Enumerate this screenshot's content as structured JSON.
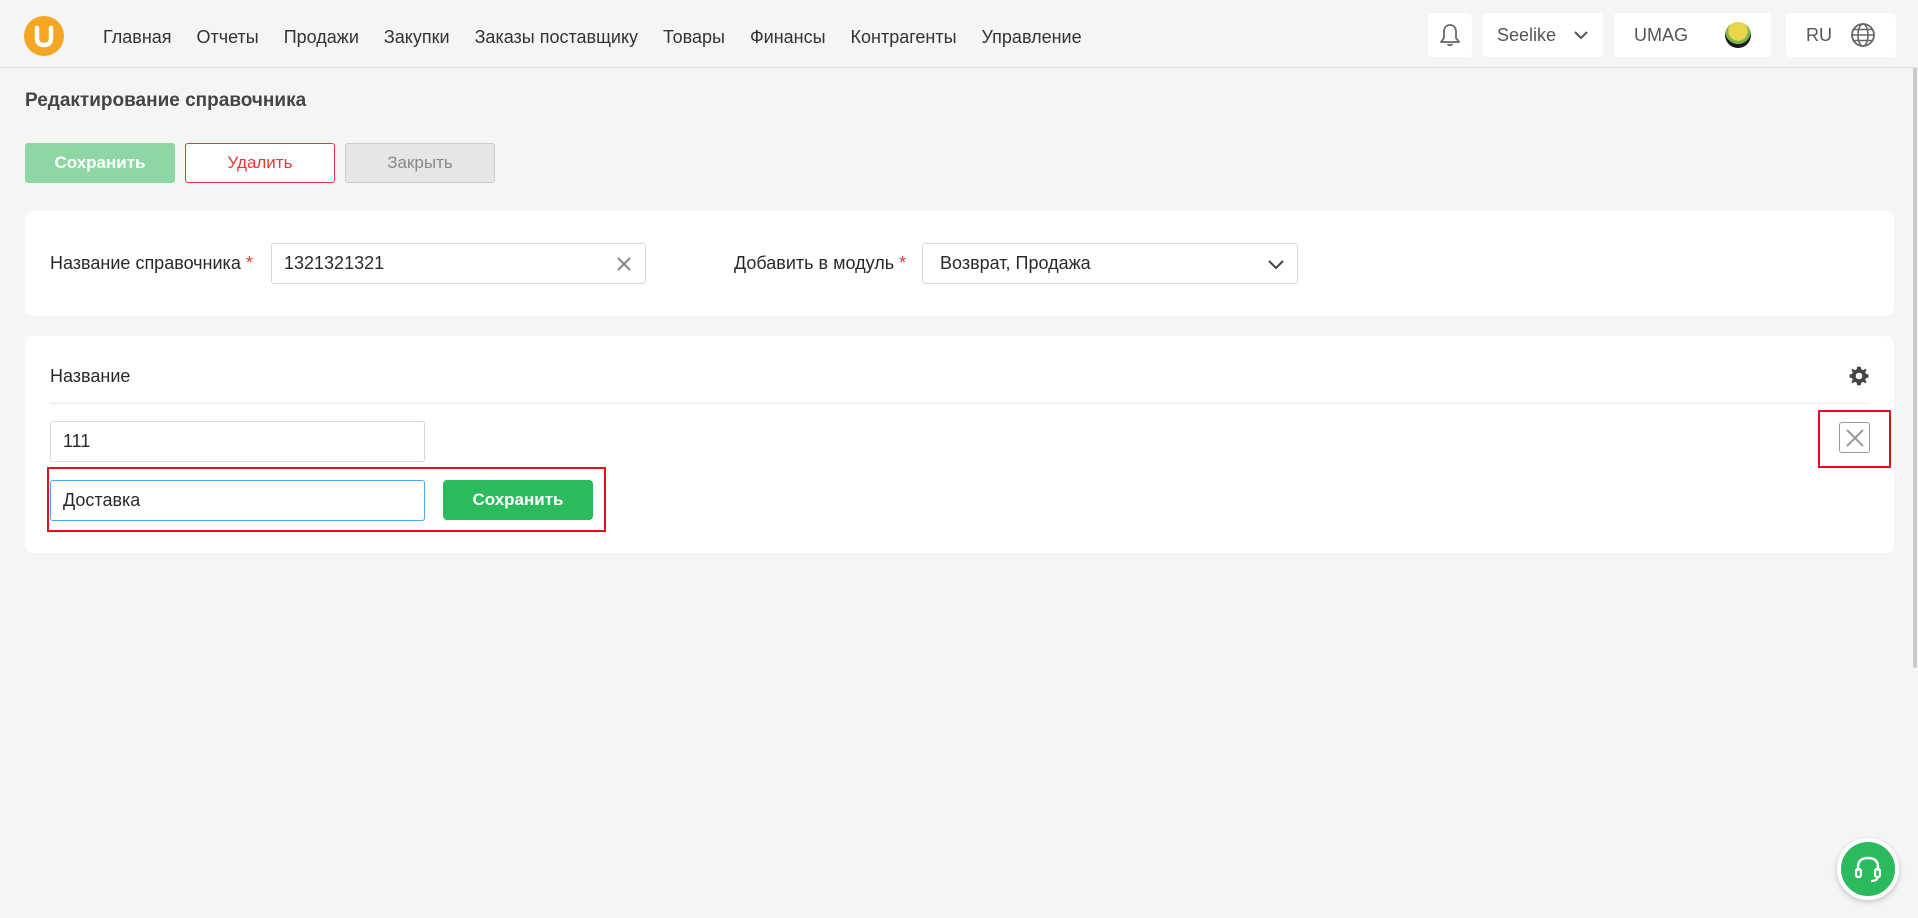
{
  "nav": {
    "items": [
      "Главная",
      "Отчеты",
      "Продажи",
      "Закупки",
      "Заказы поставщику",
      "Товары",
      "Финансы",
      "Контрагенты",
      "Управление"
    ]
  },
  "header": {
    "org_name": "Seelike",
    "brand": "UMAG",
    "language": "RU"
  },
  "page": {
    "title": "Редактирование справочника",
    "save_label": "Сохранить",
    "delete_label": "Удалить",
    "close_label": "Закрыть"
  },
  "form": {
    "name_label": "Название справочника",
    "name_value": "1321321321",
    "module_label": "Добавить в модуль",
    "module_value": "Возврат, Продажа",
    "required_mark": "*"
  },
  "table": {
    "column_title": "Название",
    "rows": [
      "111"
    ],
    "new_entry_value": "Доставка",
    "new_entry_save_label": "Сохранить"
  },
  "colors": {
    "accent_green": "#2bbb5c",
    "danger_red": "#e53935",
    "logo_orange": "#f5a623"
  },
  "icons": [
    "logo-icon",
    "bell-icon",
    "chevron-down-icon",
    "globe-icon",
    "clear-icon",
    "gear-icon",
    "close-icon",
    "headset-icon"
  ]
}
